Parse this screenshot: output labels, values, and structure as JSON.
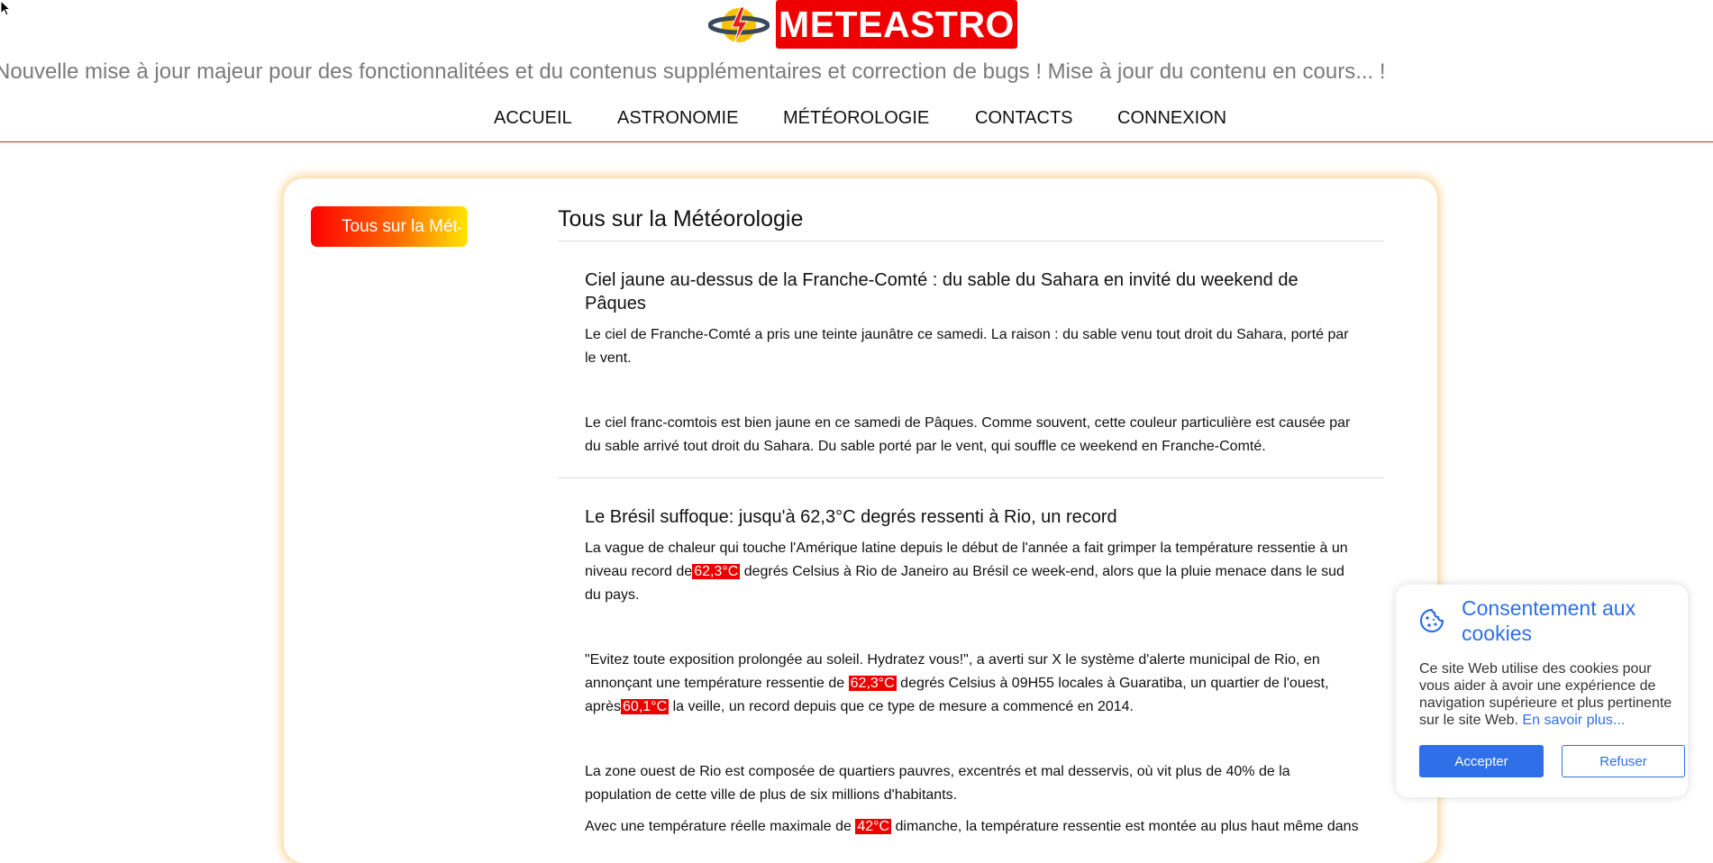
{
  "brand": {
    "name": "METEASTRO",
    "accent": "#ee0000",
    "logo_icon": "globe-lightning-icon"
  },
  "ticker": "Nouvelle mise à jour majeur pour des fonctionnalitées et du contenus supplémentaires et correction de bugs ! Mise à jour du contenu en cours... !",
  "nav": {
    "items": [
      {
        "label": "ACCUEIL"
      },
      {
        "label": "ASTRONOMIE"
      },
      {
        "label": "MÉTÉOROLOGIE"
      },
      {
        "label": "CONTACTS"
      },
      {
        "label": "CONNEXION"
      }
    ]
  },
  "sidebar": {
    "category_select": "Tous sur la Météorologie"
  },
  "main": {
    "title": "Tous sur la Météorologie",
    "articles": [
      {
        "title": "Ciel jaune au-dessus de la Franche-Comté : du sable du Sahara en invité du weekend de Pâques",
        "p1": "Le ciel de Franche-Comté a pris une teinte jaunâtre ce samedi. La raison : du sable venu tout droit du Sahara, porté par le vent.",
        "p2": "Le ciel franc-comtois est bien jaune en ce samedi de Pâques. Comme souvent, cette couleur particulière est causée par du sable arrivé tout droit du Sahara. Du sable porté par le vent, qui souffle ce weekend en Franche-Comté."
      },
      {
        "title": "Le Brésil suffoque: jusqu'à 62,3°C degrés ressenti à Rio, un record",
        "p1_a": "La vague de chaleur qui touche l'Amérique latine depuis le début de l'année a fait grimper la température ressentie à un niveau record de",
        "p1_hl": "62,3°C",
        "p1_b": " degrés Celsius à Rio de Janeiro au Brésil ce week-end, alors que la pluie menace dans le sud du pays.",
        "p2_a": "\"Evitez toute exposition prolongée au soleil. Hydratez vous!\", a averti sur X le système d'alerte municipal de Rio, en annonçant une température ressentie de ",
        "p2_hl1": "62,3°C",
        "p2_b": " degrés Celsius à 09H55 locales à Guaratiba, un quartier de l'ouest, après",
        "p2_hl2": "60,1°C",
        "p2_c": " la veille, un record depuis que ce type de mesure a commencé en 2014.",
        "p3": "La zone ouest de Rio est composée de quartiers pauvres, excentrés et mal desservis, où vit plus de 40% de la population de cette ville de plus de six millions d'habitants.",
        "p4_a": "Avec une température réelle maximale de ",
        "p4_hl": "42°C",
        "p4_b": " dimanche, la température ressentie est montée au plus haut même dans"
      }
    ]
  },
  "cookie": {
    "title": "Consentement aux cookies",
    "icon": "cookie-icon",
    "text": "Ce site Web utilise des cookies pour vous aider à avoir une expérience de navigation supérieure et plus pertinente sur le site Web.",
    "link": "En savoir plus...",
    "accept": "Accepter",
    "refuse": "Refuser",
    "color": "#2f6fe8"
  }
}
